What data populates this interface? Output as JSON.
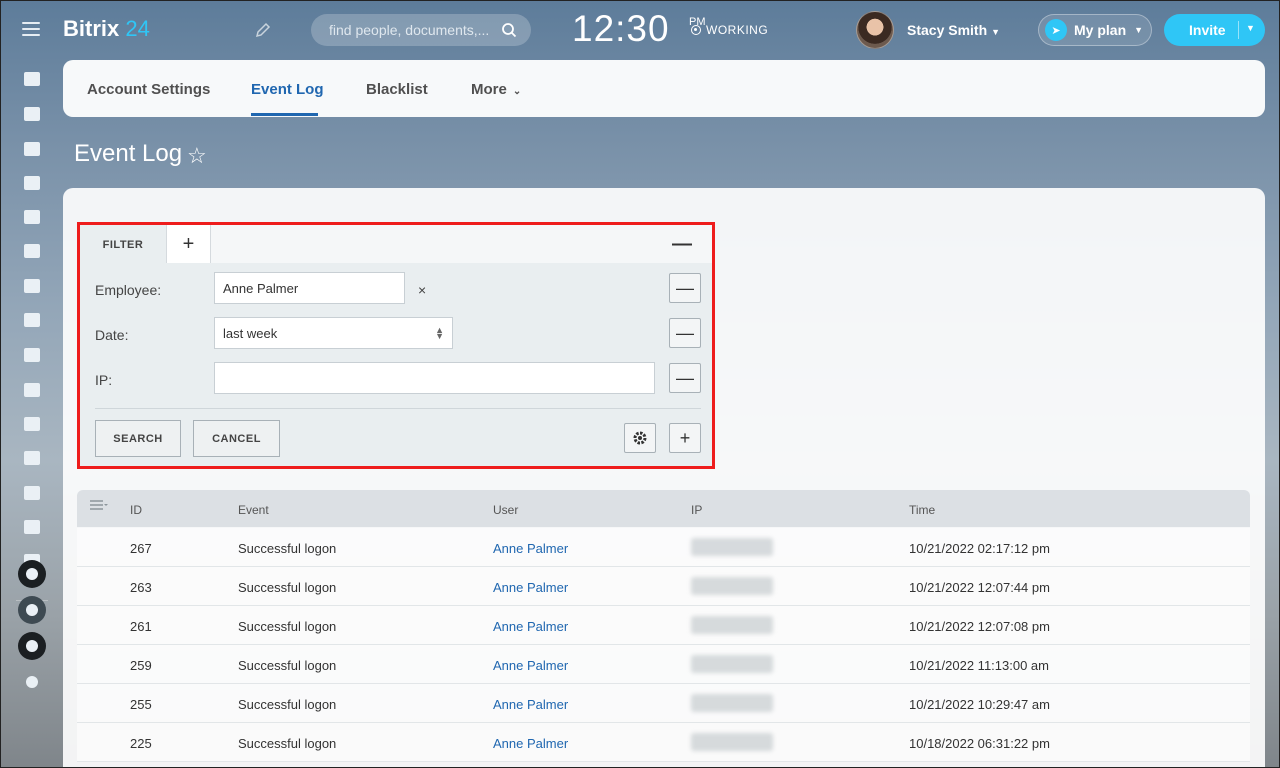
{
  "header": {
    "logo_text": "Bitrix",
    "logo_num": "24",
    "search_placeholder": "find people, documents,...",
    "clock": "12:30",
    "clock_ampm": "PM",
    "status": "WORKING",
    "user_name": "Stacy Smith",
    "plan_label": "My plan",
    "invite_label": "Invite",
    "accent_color": "#2fc6f6"
  },
  "sidebar": {
    "icons": [
      "dashboard-icon",
      "news-icon",
      "chat-icon",
      "calendar-icon",
      "docs-icon",
      "drive-icon",
      "mail-icon",
      "groups-icon",
      "tasks-icon",
      "crm-filter-icon",
      "target-icon",
      "cart-icon",
      "contact-center-icon",
      "robot-icon",
      "box-icon",
      "sites-icon",
      "settings-icon",
      "collapse-icon",
      "network-icon"
    ]
  },
  "tabs": {
    "items": [
      {
        "label": "Account Settings",
        "active": false
      },
      {
        "label": "Event Log",
        "active": true
      },
      {
        "label": "Blacklist",
        "active": false
      },
      {
        "label": "More",
        "active": false
      }
    ]
  },
  "page": {
    "title": "Event Log"
  },
  "filter": {
    "tab_label": "FILTER",
    "employee_label": "Employee:",
    "employee_value": "Anne Palmer",
    "date_label": "Date:",
    "date_value": "last week",
    "ip_label": "IP:",
    "ip_value": "",
    "search_button": "SEARCH",
    "cancel_button": "CANCEL",
    "highlight_color": "#ee1c1c"
  },
  "table": {
    "columns": [
      "ID",
      "Event",
      "User",
      "IP",
      "Time"
    ],
    "rows": [
      {
        "id": "267",
        "event": "Successful logon",
        "user": "Anne Palmer",
        "time": "10/21/2022 02:17:12 pm"
      },
      {
        "id": "263",
        "event": "Successful logon",
        "user": "Anne Palmer",
        "time": "10/21/2022 12:07:44 pm"
      },
      {
        "id": "261",
        "event": "Successful logon",
        "user": "Anne Palmer",
        "time": "10/21/2022 12:07:08 pm"
      },
      {
        "id": "259",
        "event": "Successful logon",
        "user": "Anne Palmer",
        "time": "10/21/2022 11:13:00 am"
      },
      {
        "id": "255",
        "event": "Successful logon",
        "user": "Anne Palmer",
        "time": "10/21/2022 10:29:47 am"
      },
      {
        "id": "225",
        "event": "Successful logon",
        "user": "Anne Palmer",
        "time": "10/18/2022 06:31:22 pm"
      }
    ]
  }
}
